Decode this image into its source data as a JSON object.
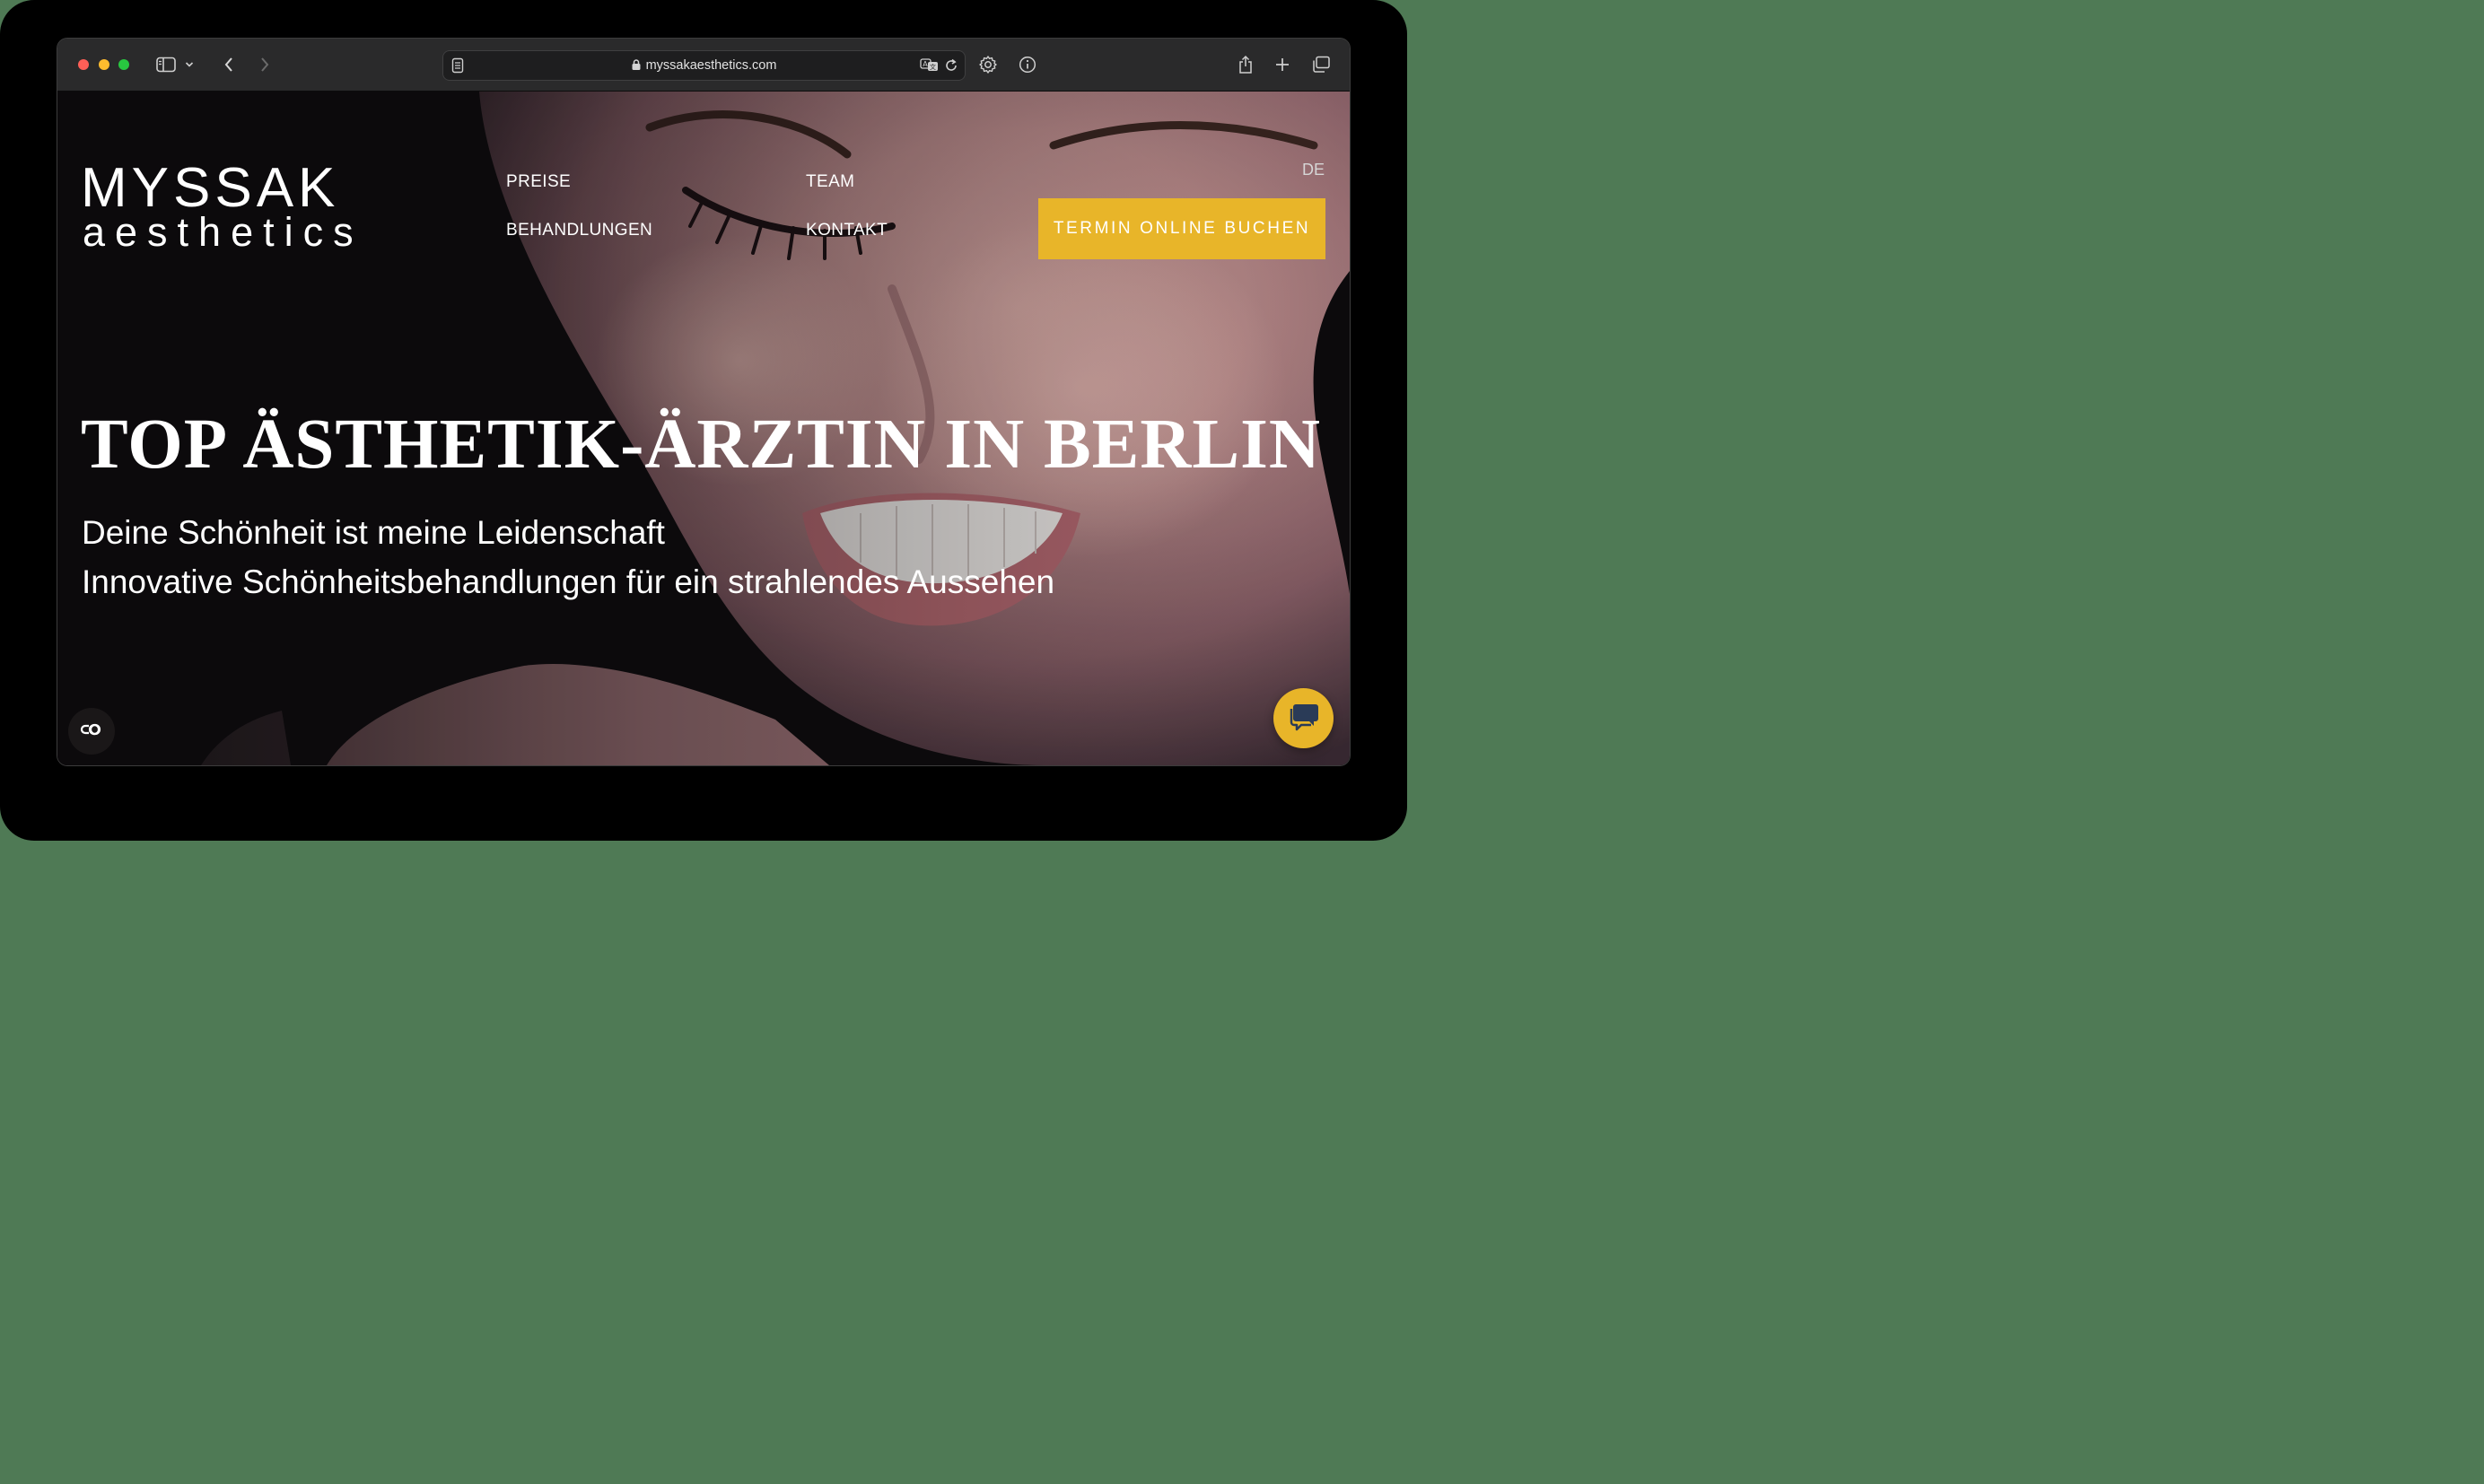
{
  "browser": {
    "url": "myssakaesthetics.com",
    "icons": [
      "sidebar-icon",
      "chevron-down-icon",
      "back-icon",
      "forward-icon",
      "reader-icon",
      "lock-icon",
      "translate-icon",
      "reload-icon",
      "gear-icon",
      "info-icon",
      "share-icon",
      "plus-icon",
      "tabs-icon"
    ]
  },
  "site": {
    "logo": {
      "line1": "MYSSAK",
      "line2": "aesthetics"
    },
    "nav": {
      "preise": "PREISE",
      "behandlungen": "BEHANDLUNGEN",
      "team": "TEAM",
      "kontakt": "KONTAKT"
    },
    "language": "DE",
    "cta_label": "TERMIN ONLINE BUCHEN",
    "headline": "TOP ÄSTHETIK-ÄRZTIN IN BERLIN",
    "subline1": "Deine Schönheit ist meine Leidenschaft",
    "subline2": "Innovative Schönheitsbehandlungen für ein strahlendes Aussehen",
    "colors": {
      "accent": "#e8b529",
      "background": "#0d0a0d",
      "text": "#ffffff"
    },
    "widgets": [
      "cookie-settings-icon",
      "chat-icon"
    ]
  }
}
